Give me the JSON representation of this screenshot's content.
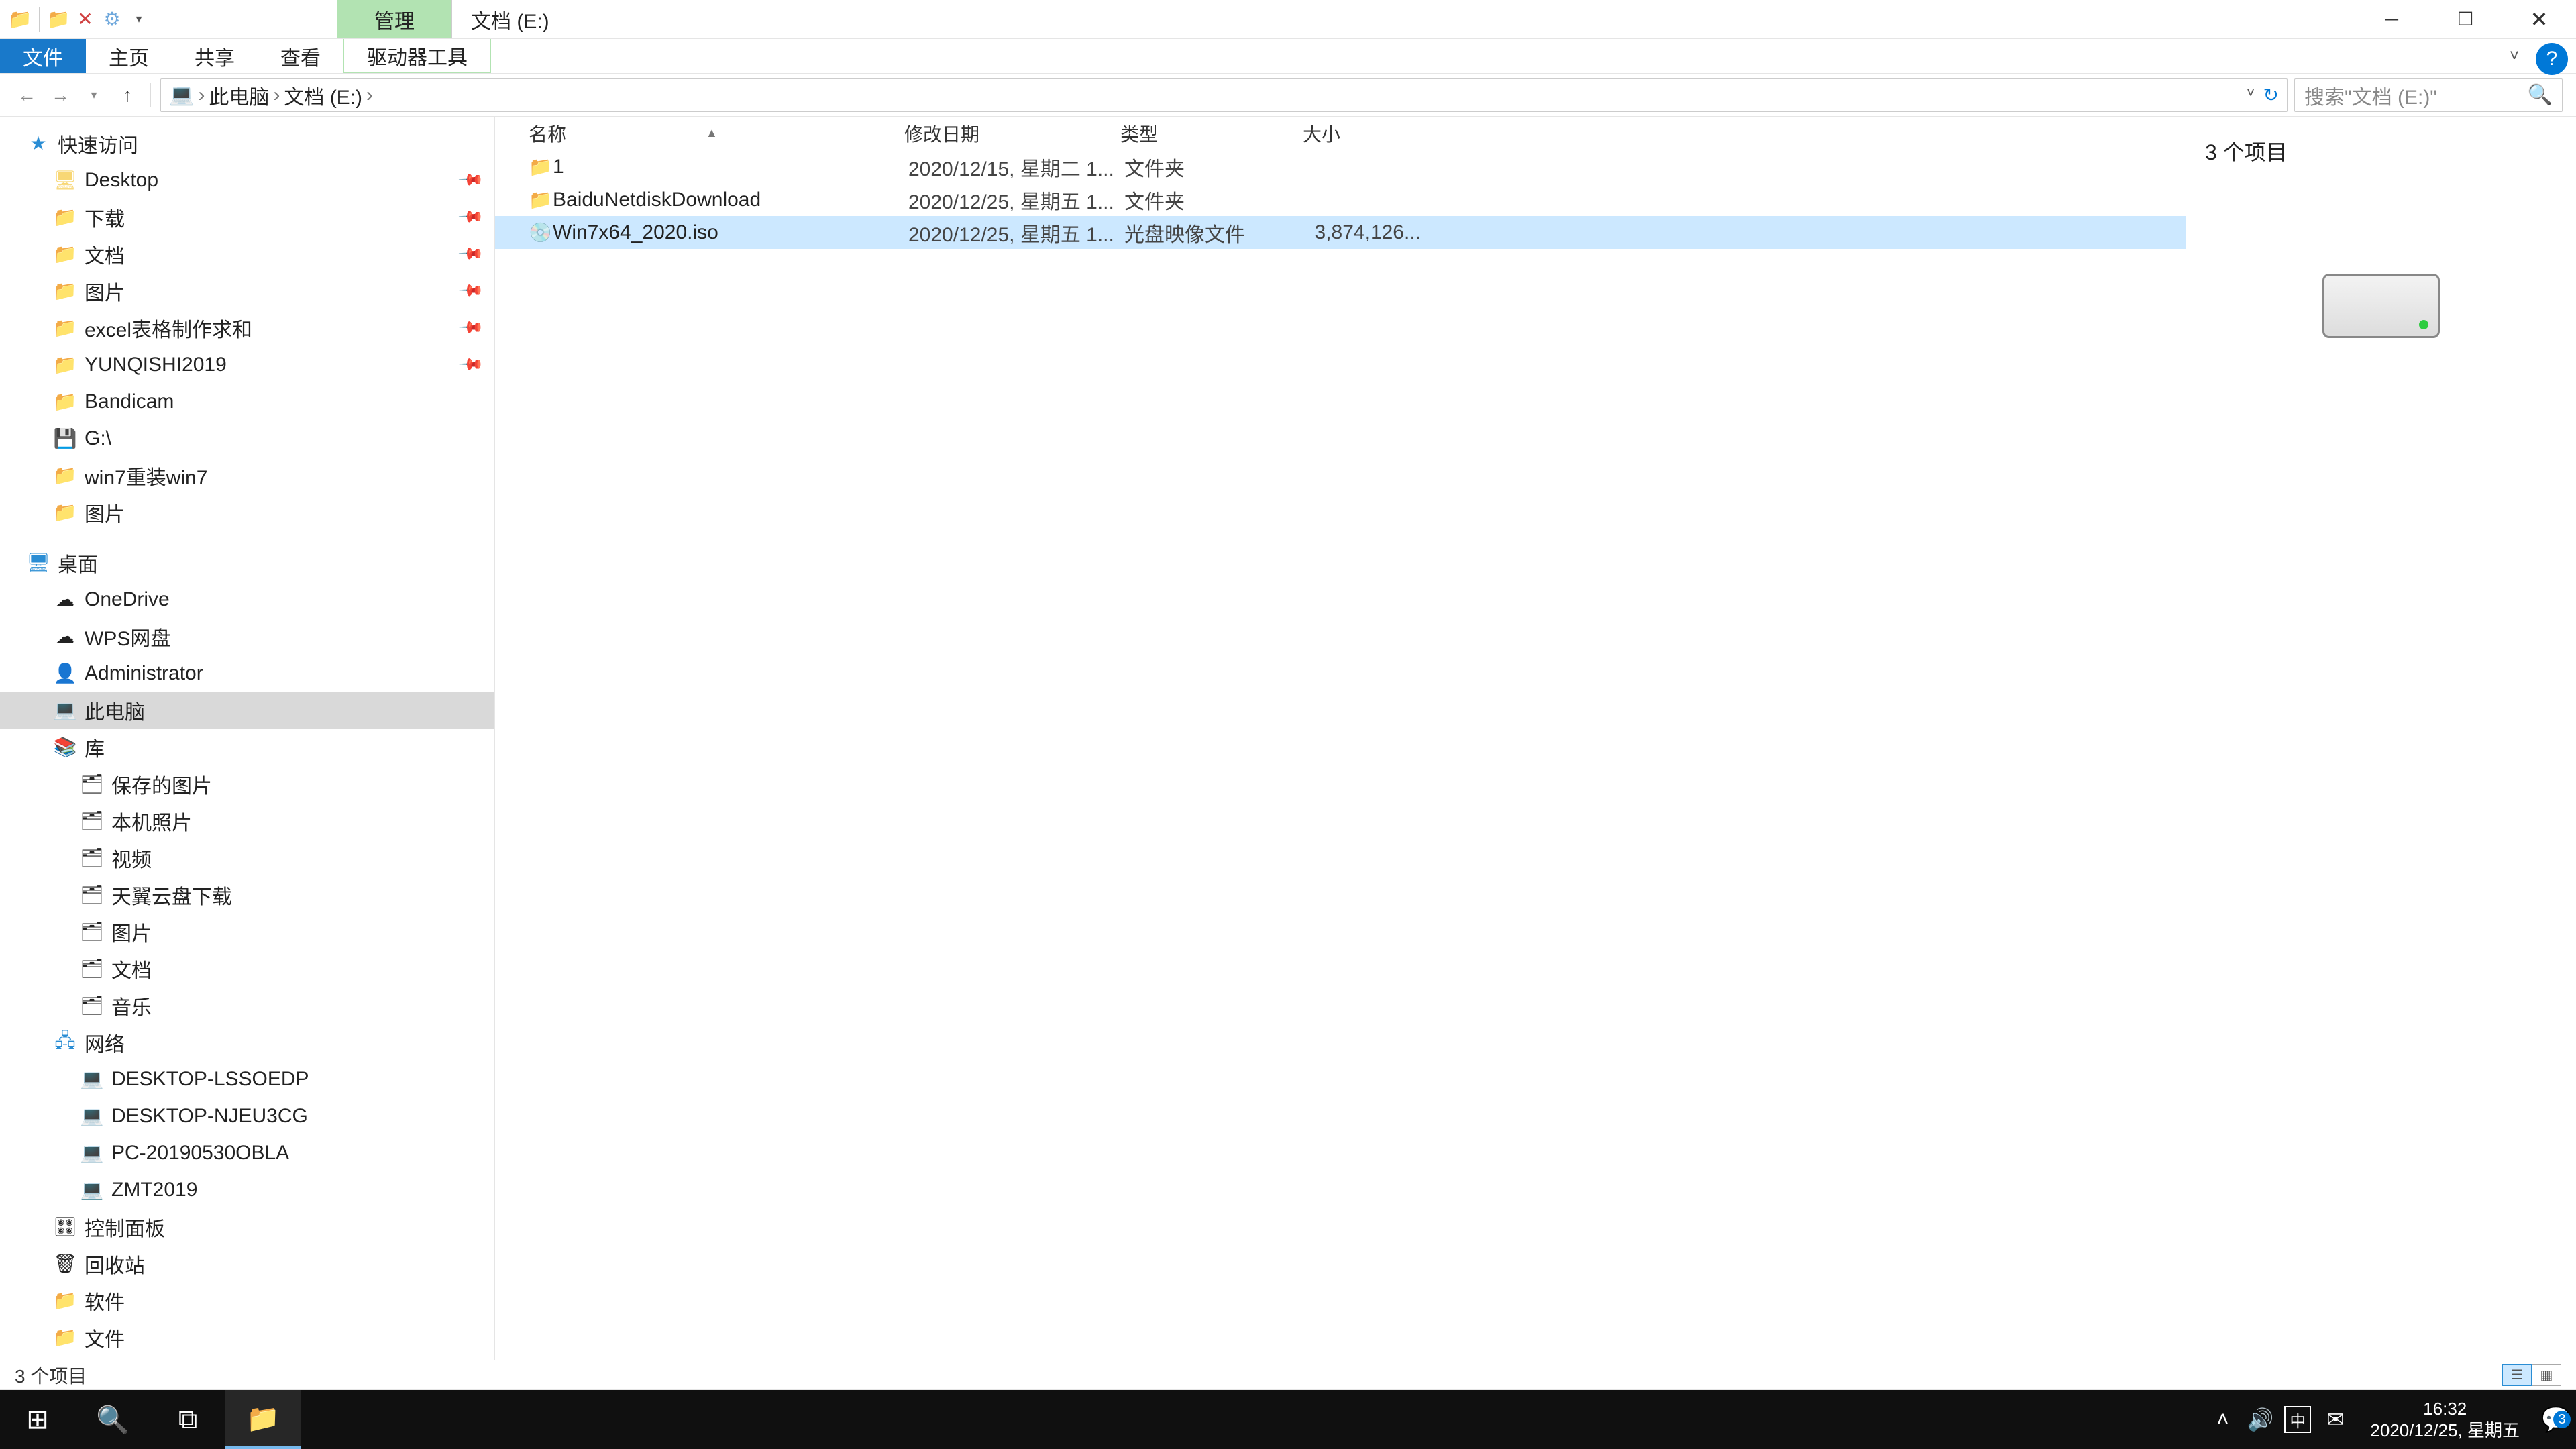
{
  "window": {
    "contextual_tab": "管理",
    "title": "文档 (E:)"
  },
  "ribbon": {
    "file": "文件",
    "home": "主页",
    "share": "共享",
    "view": "查看",
    "drive_tools": "驱动器工具"
  },
  "breadcrumbs": {
    "root": "此电脑",
    "leaf": "文档 (E:)"
  },
  "search": {
    "placeholder": "搜索\"文档 (E:)\""
  },
  "navpane": {
    "quick_access": "快速访问",
    "quick_items": [
      {
        "label": "Desktop",
        "icon": "🖥"
      },
      {
        "label": "下载",
        "icon": "📁"
      },
      {
        "label": "文档",
        "icon": "📁"
      },
      {
        "label": "图片",
        "icon": "📁"
      },
      {
        "label": "excel表格制作求和",
        "icon": "📁"
      },
      {
        "label": "YUNQISHI2019",
        "icon": "📁"
      },
      {
        "label": "Bandicam",
        "icon": "📁"
      },
      {
        "label": "G:\\",
        "icon": "💾"
      },
      {
        "label": "win7重装win7",
        "icon": "📁"
      },
      {
        "label": "图片",
        "icon": "📁"
      }
    ],
    "desktop": "桌面",
    "desktop_items": [
      {
        "label": "OneDrive",
        "icon": "☁"
      },
      {
        "label": "WPS网盘",
        "icon": "☁"
      },
      {
        "label": "Administrator",
        "icon": "👤"
      },
      {
        "label": "此电脑",
        "icon": "💻",
        "selected": true
      },
      {
        "label": "库",
        "icon": "📚"
      }
    ],
    "library_items": [
      {
        "label": "保存的图片"
      },
      {
        "label": "本机照片"
      },
      {
        "label": "视频"
      },
      {
        "label": "天翼云盘下载"
      },
      {
        "label": "图片"
      },
      {
        "label": "文档"
      },
      {
        "label": "音乐"
      }
    ],
    "network": "网络",
    "network_items": [
      {
        "label": "DESKTOP-LSSOEDP"
      },
      {
        "label": "DESKTOP-NJEU3CG"
      },
      {
        "label": "PC-20190530OBLA"
      },
      {
        "label": "ZMT2019"
      }
    ],
    "bottom_items": [
      {
        "label": "控制面板",
        "icon": "🎛"
      },
      {
        "label": "回收站",
        "icon": "🗑"
      },
      {
        "label": "软件",
        "icon": "📁"
      },
      {
        "label": "文件",
        "icon": "📁"
      }
    ]
  },
  "columns": {
    "name": "名称",
    "date": "修改日期",
    "type": "类型",
    "size": "大小"
  },
  "rows": [
    {
      "name": "1",
      "date": "2020/12/15, 星期二 1...",
      "type": "文件夹",
      "size": "",
      "icon": "📁"
    },
    {
      "name": "BaiduNetdiskDownload",
      "date": "2020/12/25, 星期五 1...",
      "type": "文件夹",
      "size": "",
      "icon": "📁"
    },
    {
      "name": "Win7x64_2020.iso",
      "date": "2020/12/25, 星期五 1...",
      "type": "光盘映像文件",
      "size": "3,874,126...",
      "icon": "💿",
      "selected": true
    }
  ],
  "preview": {
    "count": "3 个项目"
  },
  "statusbar": {
    "text": "3 个项目"
  },
  "clock": {
    "time": "16:32",
    "date": "2020/12/25, 星期五"
  },
  "ime": "中",
  "notif_count": "3"
}
